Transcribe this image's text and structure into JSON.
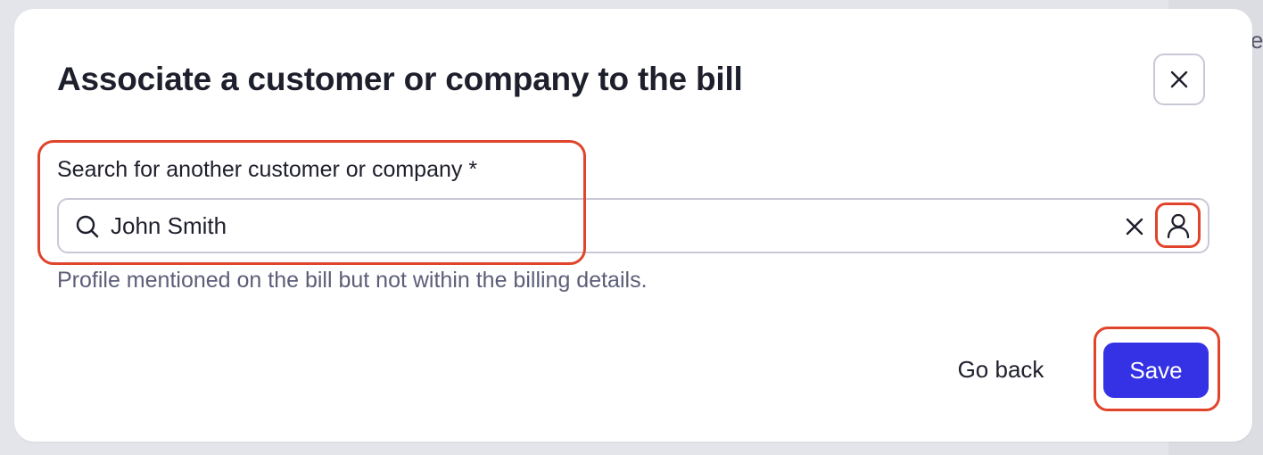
{
  "dialog": {
    "title": "Associate a customer or company to the bill",
    "close_icon": "close-icon"
  },
  "search": {
    "label": "Search for another customer or company *",
    "value": "John Smith",
    "search_icon": "search-icon",
    "clear_icon": "clear-icon",
    "profile_icon": "user-icon",
    "helper": "Profile mentioned on the bill but not within the billing details."
  },
  "actions": {
    "go_back_label": "Go back",
    "save_label": "Save"
  },
  "background": {
    "partial_text": "e"
  },
  "colors": {
    "primary": "#3432e4",
    "highlight": "#e0442b",
    "text": "#1e1f2c",
    "muted_text": "#5c5e78",
    "border": "#c8c9d6"
  }
}
